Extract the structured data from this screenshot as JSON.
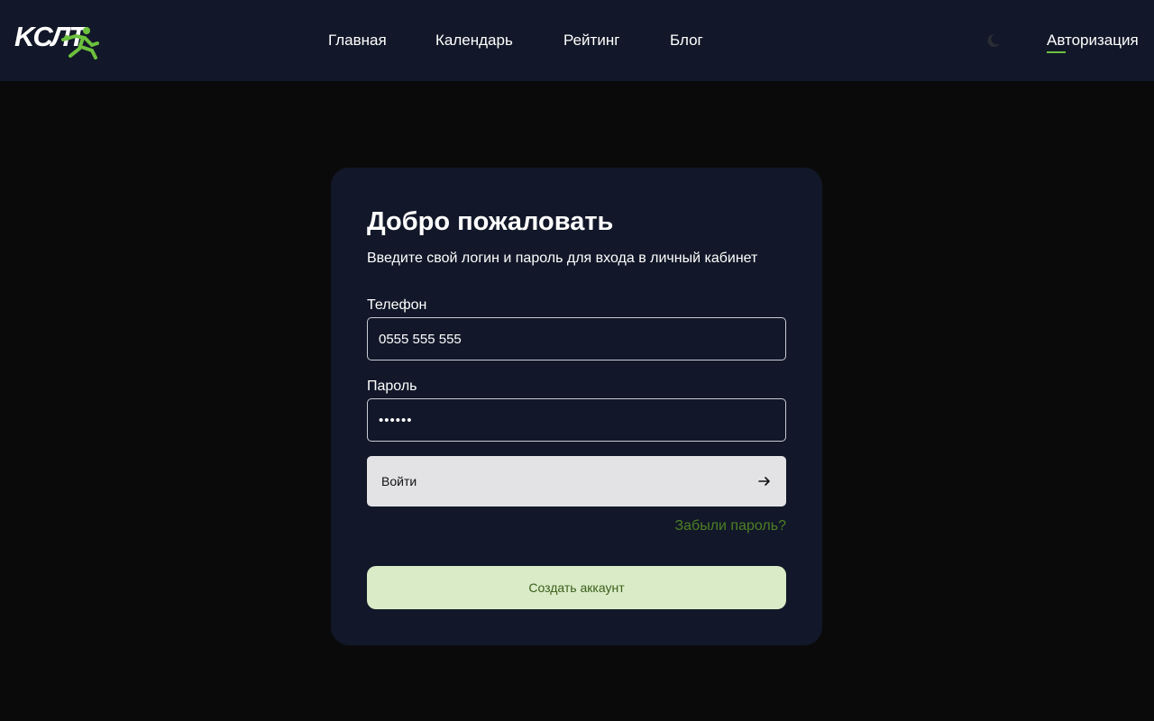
{
  "header": {
    "logo_text": "KCЛТ",
    "nav": {
      "home": "Главная",
      "calendar": "Календарь",
      "rating": "Рейтинг",
      "blog": "Блог"
    },
    "auth": "Авторизация",
    "theme_icon": "moon-icon",
    "accent_color": "#6cc13d"
  },
  "login_card": {
    "title": "Добро пожаловать",
    "subtitle": "Введите свой логин и пароль для входа в личный кабинет",
    "phone_label": "Телефон",
    "phone_value": "0555 555 555",
    "password_label": "Пароль",
    "password_value": "••••••",
    "login_button": "Войти",
    "login_icon": "arrow-right-icon",
    "forgot_password": "Забыли пароль?",
    "create_account": "Создать аккаунт"
  }
}
